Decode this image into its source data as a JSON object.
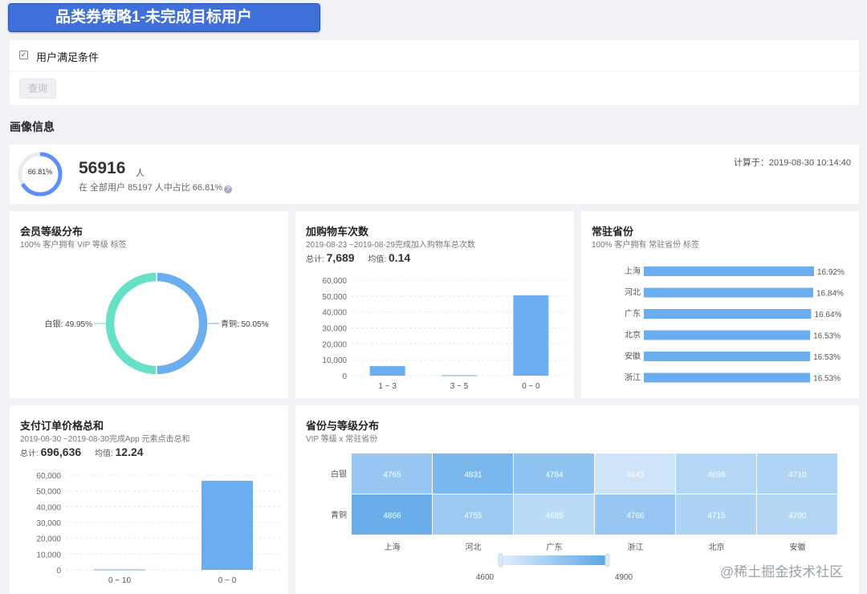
{
  "page": {
    "banner_title": "品类券策略1-未完成目标用户",
    "filter_label": "用户满足条件",
    "query_button": "查询",
    "section_title": "画像信息",
    "watermark": "@稀土掘金技术社区"
  },
  "summary": {
    "ring_percent_text": "66.81%",
    "ring_fraction": 0.6681,
    "user_count": "56916",
    "user_unit": "人",
    "sub_text": "在 全部用户 85197 人中占比 66.81%",
    "calc_time": "计算于：2019-08-30 10:14:40"
  },
  "colors": {
    "accent": "#5b8ff9",
    "bar": "#6aaef0",
    "teal": "#66e0c6",
    "banner": "#3f6fd8"
  },
  "membership": {
    "title": "会员等级分布",
    "subtitle": "100% 客户拥有 VIP 等级 标签",
    "chart_data": {
      "type": "pie",
      "categories": [
        "白银",
        "青铜"
      ],
      "values": [
        49.95,
        50.05
      ],
      "labels": [
        "白银: 49.95%",
        "青铜: 50.05%"
      ],
      "colors": [
        "#66e0c6",
        "#6aaef0"
      ]
    }
  },
  "cart": {
    "title": "加购物车次数",
    "subtitle": "2019-08-23 ~2019-08-29完成加入购物车总次数",
    "total_label": "总计:",
    "total_value": "7,689",
    "avg_label": "均值:",
    "avg_value": "0.14",
    "chart_data": {
      "type": "bar",
      "categories": [
        "1 ~ 3",
        "3 ~ 5",
        "0 ~ 0"
      ],
      "values": [
        6000,
        300,
        50500
      ],
      "ylim": [
        0,
        60000
      ],
      "yticks": [
        "60,000",
        "50,000",
        "40,000",
        "30,000",
        "20,000",
        "10,000",
        "0"
      ],
      "ytick_values": [
        60000,
        50000,
        40000,
        30000,
        20000,
        10000,
        0
      ]
    }
  },
  "province": {
    "title": "常驻省份",
    "subtitle": "100% 客户拥有 常驻省份 标签",
    "chart_data": {
      "type": "bar",
      "orientation": "horizontal",
      "categories": [
        "上海",
        "河北",
        "广东",
        "北京",
        "安徽",
        "浙江"
      ],
      "values": [
        16.92,
        16.84,
        16.64,
        16.53,
        16.53,
        16.53
      ],
      "labels": [
        "16.92%",
        "16.84%",
        "16.64%",
        "16.53%",
        "16.53%",
        "16.53%"
      ]
    }
  },
  "payment": {
    "title": "支付订单价格总和",
    "subtitle": "2019-08-30 ~2019-08-30完成App 元素点击总和",
    "total_label": "总计:",
    "total_value": "696,636",
    "avg_label": "均值:",
    "avg_value": "12.24",
    "chart_data": {
      "type": "bar",
      "categories": [
        "0 ~ 10",
        "0 ~ 0"
      ],
      "values": [
        300,
        56500
      ],
      "ylim": [
        0,
        60000
      ],
      "yticks": [
        "60,000",
        "50,000",
        "40,000",
        "30,000",
        "20,000",
        "10,000",
        "0"
      ],
      "ytick_values": [
        60000,
        50000,
        40000,
        30000,
        20000,
        10000,
        0
      ]
    }
  },
  "heatmap": {
    "title": "省份与等级分布",
    "subtitle": "VIP 等级 x 常驻省份",
    "chart_data": {
      "type": "heatmap",
      "x": [
        "上海",
        "河北",
        "广东",
        "浙江",
        "北京",
        "安徽"
      ],
      "y": [
        "白银",
        "青铜"
      ],
      "values": [
        [
          4765,
          4831,
          4784,
          4643,
          4696,
          4710
        ],
        [
          4866,
          4755,
          4685,
          4766,
          4715,
          4700
        ]
      ],
      "scale_min_label": "4600",
      "scale_max_label": "4900",
      "scale": [
        4600,
        4900
      ]
    }
  }
}
